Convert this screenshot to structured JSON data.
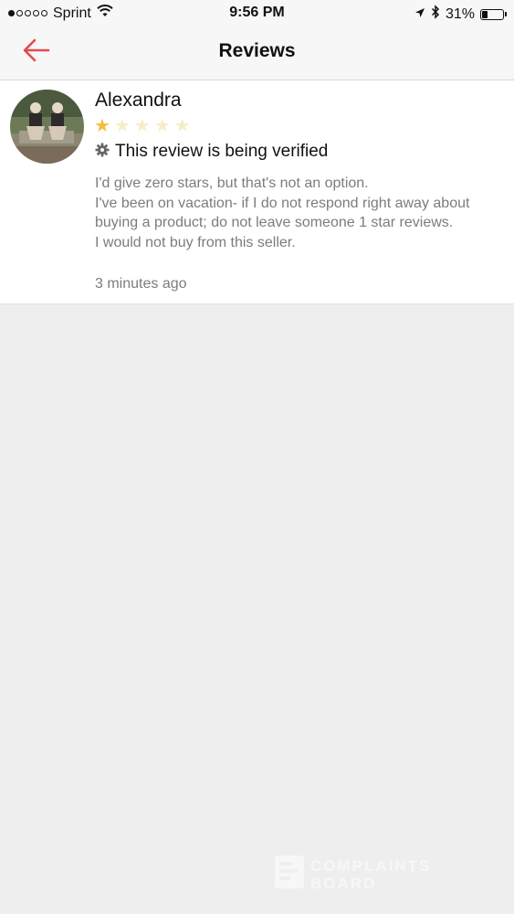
{
  "status_bar": {
    "carrier": "Sprint",
    "time": "9:56 PM",
    "battery_percent": "31%",
    "battery_level": 0.31,
    "signal_bars_filled": 1,
    "signal_bars_total": 5
  },
  "nav": {
    "title": "Reviews",
    "back_icon": "arrow-left-icon"
  },
  "review": {
    "reviewer_name": "Alexandra",
    "rating": 1,
    "max_rating": 5,
    "verification_status": "This review is being verified",
    "body_lines": [
      "I'd give zero stars, but that's not an option.",
      "I've been on vacation- if I do not respond right away about buying a product; do not leave someone 1 star reviews.",
      "I would not buy from this seller."
    ],
    "time_ago": "3 minutes ago"
  },
  "watermark": {
    "line1": "COMPLAINTS",
    "line2": "BOARD"
  },
  "colors": {
    "accent": "#e04b4b",
    "star_on": "#f1bf3a",
    "star_off": "#f7ecc9",
    "background": "#efeeef",
    "secondary_text": "#7c7c7c"
  }
}
